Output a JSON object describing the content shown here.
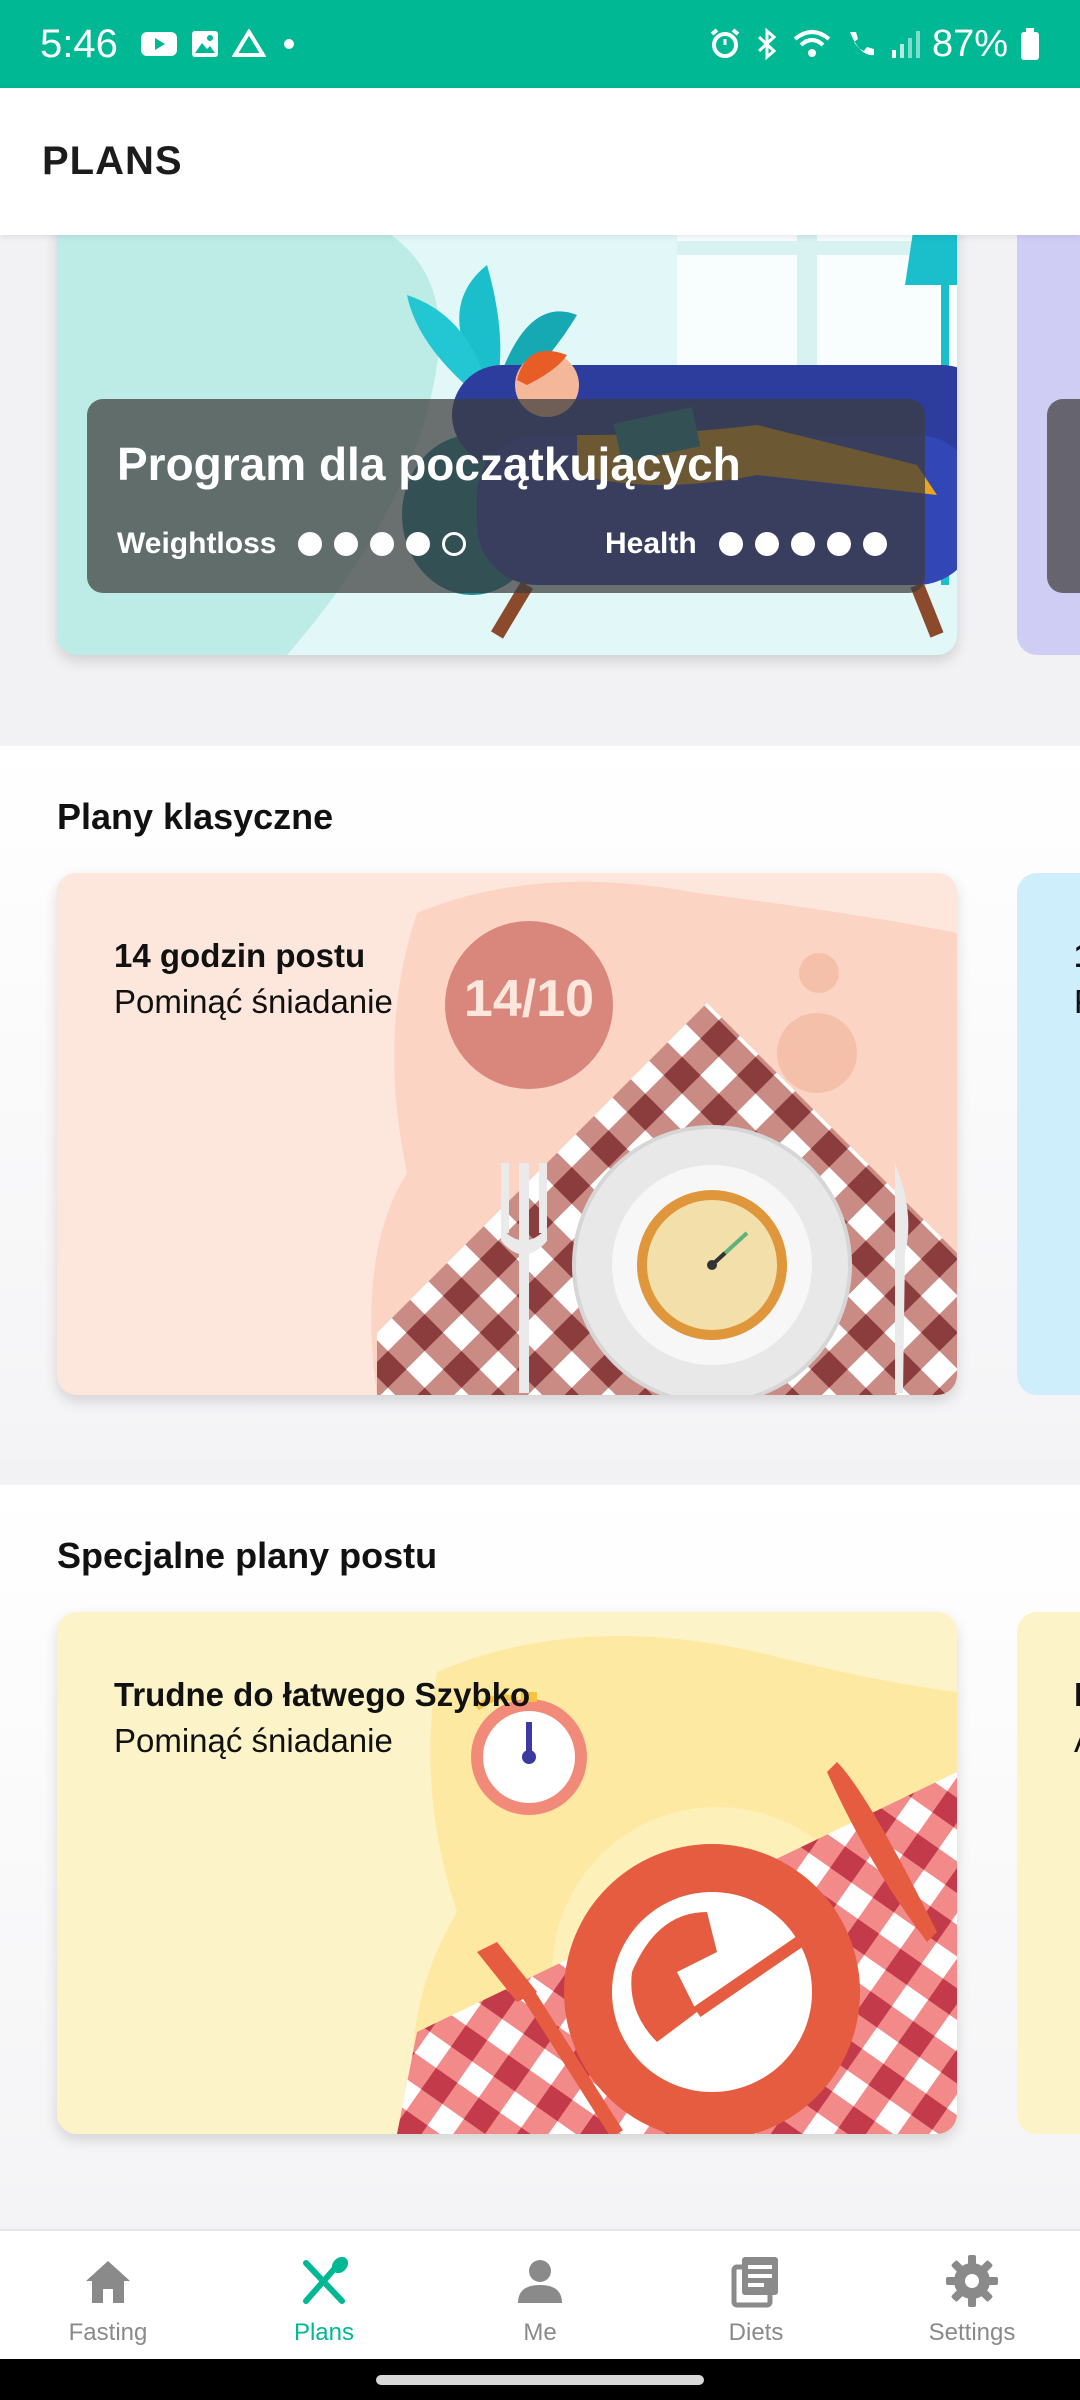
{
  "status_bar": {
    "time": "5:46",
    "battery": "87%"
  },
  "header": {
    "title": "PLANS"
  },
  "program_card": {
    "title": "Program dla początkujących",
    "tag1": {
      "label": "Weightloss",
      "filled": 4,
      "total": 5
    },
    "tag2": {
      "label": "Health",
      "filled": 5,
      "total": 5
    }
  },
  "sections": [
    {
      "title": "Plany klasyczne",
      "card": {
        "title": "14 godzin postu",
        "subtitle": "Pominąć śniadanie",
        "badge": "14/10"
      }
    },
    {
      "title": "Specjalne plany postu",
      "card": {
        "title": "Trudne do łatwego Szybko",
        "subtitle": "Pominąć śniadanie"
      }
    }
  ],
  "peek_letters": [
    "1",
    "P",
    "I",
    "A"
  ],
  "bottom_nav": [
    {
      "label": "Fasting",
      "icon": "home-icon",
      "active": false
    },
    {
      "label": "Plans",
      "icon": "fork-spoon-icon",
      "active": true
    },
    {
      "label": "Me",
      "icon": "person-icon",
      "active": false
    },
    {
      "label": "Diets",
      "icon": "articles-icon",
      "active": false
    },
    {
      "label": "Settings",
      "icon": "gear-icon",
      "active": false
    }
  ],
  "colors": {
    "accent": "#00b894",
    "nav_inactive": "#8a8a8a"
  }
}
